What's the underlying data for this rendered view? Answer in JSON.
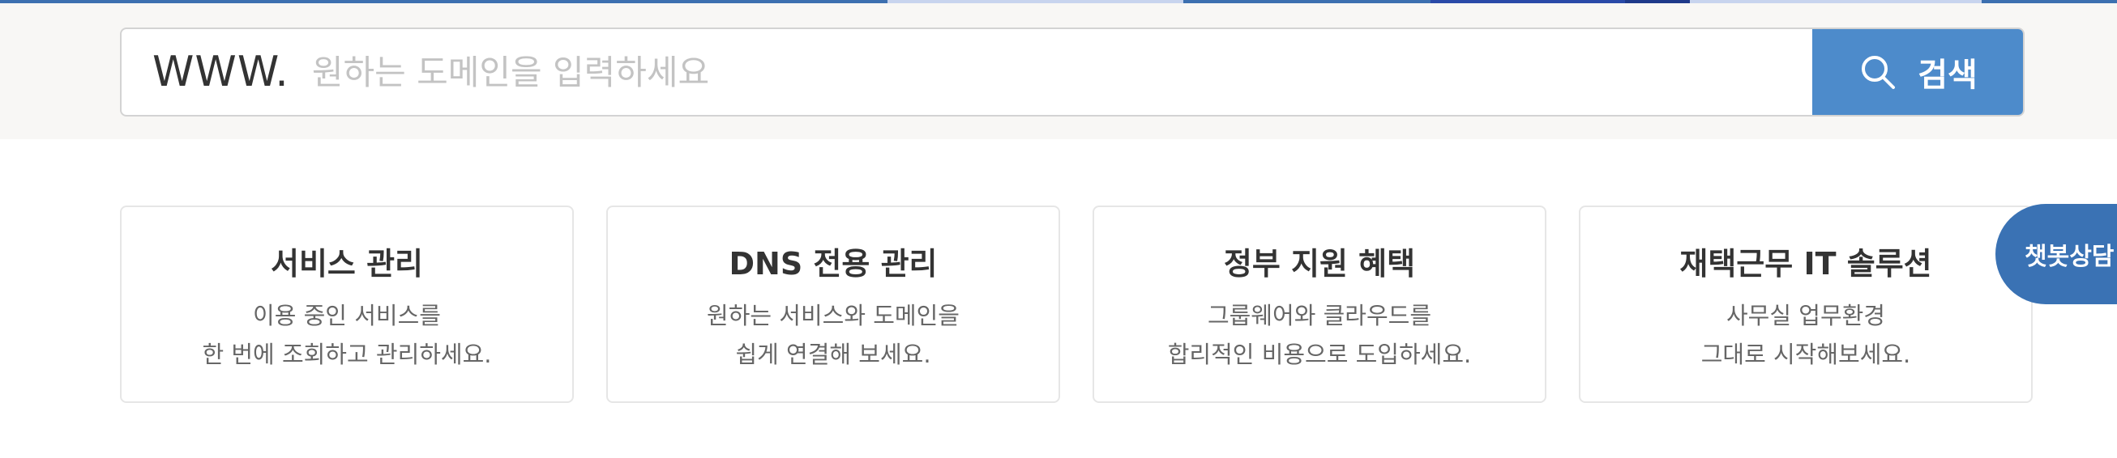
{
  "search": {
    "prefix": "WWW.",
    "placeholder": "원하는 도메인을 입력하세요",
    "value": "",
    "button_label": "검색",
    "button_icon": "search-icon"
  },
  "cards": [
    {
      "title": "서비스 관리",
      "line1": "이용 중인 서비스를",
      "line2": "한 번에 조회하고 관리하세요."
    },
    {
      "title": "DNS 전용 관리",
      "line1": "원하는 서비스와 도메인을",
      "line2": "쉽게 연결해 보세요."
    },
    {
      "title": "정부 지원 혜택",
      "line1": "그룹웨어와 클라우드를",
      "line2": "합리적인 비용으로 도입하세요."
    },
    {
      "title": "재택근무 IT 솔루션",
      "line1": "사무실 업무환경",
      "line2": "그대로 시작해보세요."
    }
  ],
  "chatbot": {
    "label": "챗봇상담"
  },
  "colors": {
    "accent": "#4d8bcb",
    "chatbot": "#3a72b4",
    "band_bg": "#f8f7f5",
    "card_border": "#e6e6e6",
    "top_strip": [
      "#3d70b0",
      "#c8d4ee",
      "#3d70b0",
      "#2a4aa8",
      "#1f3a8a",
      "#c8d4ee",
      "#3d70b0"
    ]
  }
}
